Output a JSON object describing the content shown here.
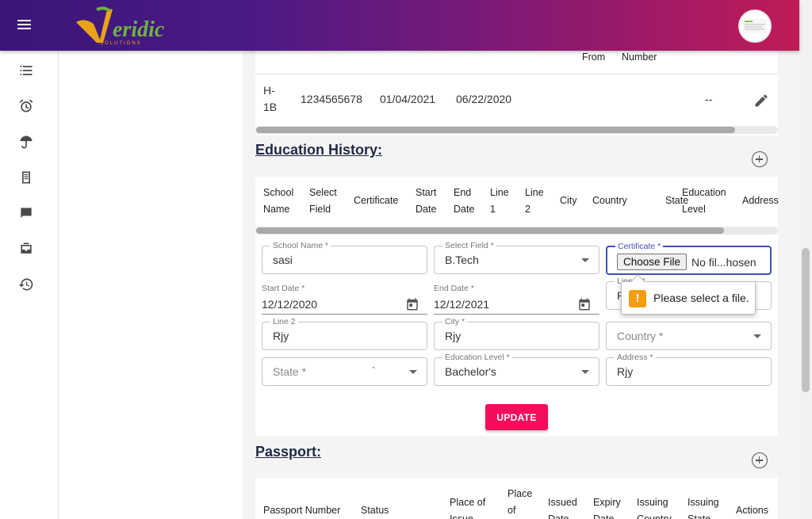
{
  "header": {
    "logo_text": "Veridic",
    "logo_subtext": "SOLUTIONS"
  },
  "sidebar": {
    "items": [
      {
        "icon": "checklist-icon"
      },
      {
        "icon": "alarm-icon"
      },
      {
        "icon": "umbrella-icon"
      },
      {
        "icon": "document-icon"
      },
      {
        "icon": "chat-icon"
      },
      {
        "icon": "inbox-icon"
      },
      {
        "icon": "history-icon"
      }
    ]
  },
  "visa_table": {
    "header_from": "From",
    "header_number": "Number",
    "row": {
      "type": "H-\n1B",
      "number": "1234565678",
      "date1": "01/04/2021",
      "date2": "06/22/2020",
      "dash": "--"
    }
  },
  "education": {
    "title": "Education History:",
    "columns": [
      "School Name",
      "Select Field",
      "Certificate",
      "Start Date",
      "End Date",
      "Line 1",
      "Line 2",
      "City",
      "Country",
      "State",
      "Education Level",
      "Address"
    ],
    "form": {
      "school_name": {
        "label": "School Name *",
        "value": "sasi"
      },
      "select_field": {
        "label": "Select Field *",
        "value": "B.Tech"
      },
      "certificate": {
        "label": "Certificate *",
        "button": "Choose File",
        "file_text": "No fil...hosen"
      },
      "start_date": {
        "label": "Start Date *",
        "value": "12/12/2020"
      },
      "end_date": {
        "label": "End Date *",
        "value": "12/12/2021"
      },
      "line1": {
        "label": "Line 1 *",
        "value": "R"
      },
      "line2": {
        "label": "Line 2",
        "value": "Rjy"
      },
      "city": {
        "label": "City *",
        "value": "Rjy"
      },
      "country": {
        "placeholder": "Country *"
      },
      "state": {
        "placeholder": "State *",
        "extra": "`"
      },
      "education_level": {
        "label": "Education Level *",
        "value": "Bachelor's"
      },
      "address": {
        "label": "Address *",
        "value": "Rjy"
      }
    },
    "tooltip": "Please select a file.",
    "update_label": "UPDATE"
  },
  "passport": {
    "title": "Passport:",
    "columns": [
      "Passport Number",
      "Status",
      "Place of Issue",
      "Place of Birth",
      "Issued Date",
      "Expiry Date",
      "Issuing Country",
      "Issuing State",
      "Actions"
    ]
  },
  "colors": {
    "accent": "#f40e5a",
    "header_start": "#3a1677",
    "header_end": "#c01b57",
    "focus": "#3f51b5",
    "warning": "#f49e0f"
  }
}
